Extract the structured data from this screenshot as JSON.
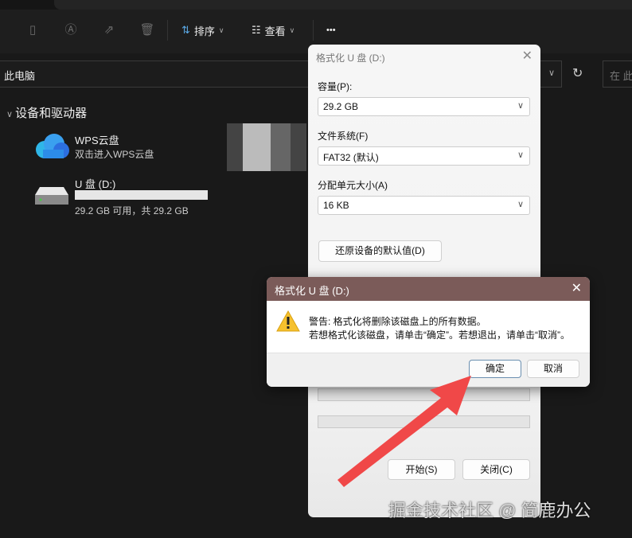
{
  "toolbar": {
    "sort": "排序",
    "view": "查看",
    "more": "•••"
  },
  "address": {
    "path": "此电脑",
    "search_placeholder": "在 此"
  },
  "section": {
    "title": "设备和驱动器"
  },
  "drives": [
    {
      "name": "WPS云盘",
      "sub": "双击进入WPS云盘"
    },
    {
      "name": "U 盘 (D:)",
      "sub": "29.2 GB 可用，共 29.2 GB",
      "used_fraction": 0.0
    }
  ],
  "format_dialog": {
    "title": "格式化 U 盘 (D:)",
    "capacity_label": "容量(P):",
    "capacity_value": "29.2 GB",
    "fs_label": "文件系统(F)",
    "fs_value": "FAT32 (默认)",
    "unit_label": "分配单元大小(A)",
    "unit_value": "16 KB",
    "restore_button": "还原设备的默认值(D)",
    "start_button": "开始(S)",
    "close_button": "关闭(C)"
  },
  "message_box": {
    "title": "格式化 U 盘 (D:)",
    "line1": "警告: 格式化将删除该磁盘上的所有数据。",
    "line2": "若想格式化该磁盘，请单击“确定”。若想退出，请单击“取消”。",
    "ok": "确定",
    "cancel": "取消"
  },
  "watermark": "掘金技术社区 @ 简鹿办公",
  "colors": {
    "titlebar": "#7b5b59",
    "arrow": "#f04848"
  }
}
